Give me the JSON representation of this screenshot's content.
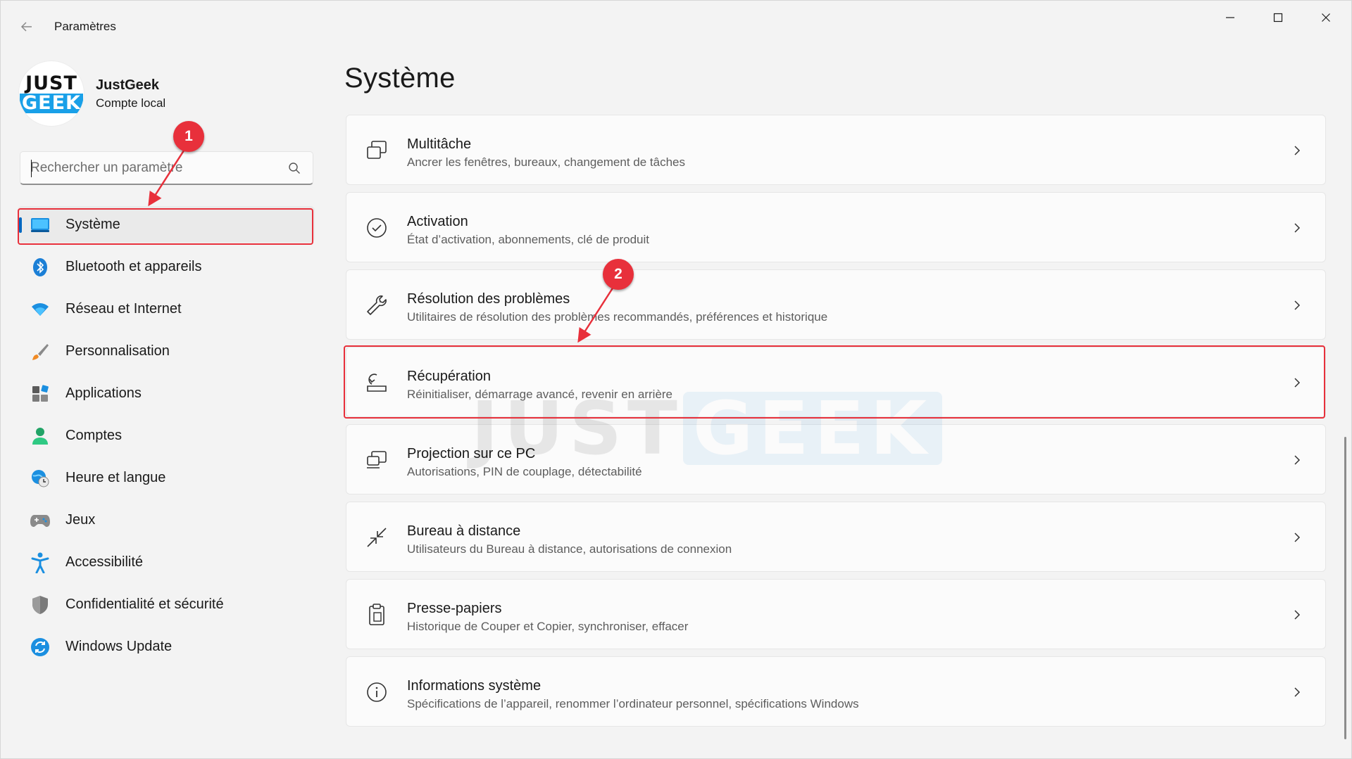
{
  "window": {
    "title": "Paramètres",
    "back_icon": "arrow-left-icon",
    "controls": [
      "minimize-icon",
      "maximize-icon",
      "close-icon"
    ]
  },
  "profile": {
    "avatar_line1": "JUST",
    "avatar_line2": "GEEK",
    "name": "JustGeek",
    "account_type": "Compte local"
  },
  "search": {
    "placeholder": "Rechercher un paramètre",
    "icon": "search-icon"
  },
  "sidebar": {
    "items": [
      {
        "label": "Système",
        "icon": "system-icon",
        "active": true
      },
      {
        "label": "Bluetooth et appareils",
        "icon": "bluetooth-icon"
      },
      {
        "label": "Réseau et Internet",
        "icon": "wifi-icon"
      },
      {
        "label": "Personnalisation",
        "icon": "brush-icon"
      },
      {
        "label": "Applications",
        "icon": "apps-icon"
      },
      {
        "label": "Comptes",
        "icon": "person-icon"
      },
      {
        "label": "Heure et langue",
        "icon": "globe-clock-icon"
      },
      {
        "label": "Jeux",
        "icon": "gamepad-icon"
      },
      {
        "label": "Accessibilité",
        "icon": "accessibility-icon"
      },
      {
        "label": "Confidentialité et sécurité",
        "icon": "shield-icon"
      },
      {
        "label": "Windows Update",
        "icon": "update-icon"
      }
    ]
  },
  "main": {
    "title": "Système",
    "cards": [
      {
        "title": "Multitâche",
        "subtitle": "Ancrer les fenêtres, bureaux, changement de tâches",
        "icon": "multitask-icon"
      },
      {
        "title": "Activation",
        "subtitle": "État d’activation, abonnements, clé de produit",
        "icon": "check-circle-icon"
      },
      {
        "title": "Résolution des problèmes",
        "subtitle": "Utilitaires de résolution des problèmes recommandés, préférences et historique",
        "icon": "wrench-icon"
      },
      {
        "title": "Récupération",
        "subtitle": "Réinitialiser, démarrage avancé, revenir en arrière",
        "icon": "recovery-icon"
      },
      {
        "title": "Projection sur ce PC",
        "subtitle": "Autorisations, PIN de couplage, détectabilité",
        "icon": "projection-icon"
      },
      {
        "title": "Bureau à distance",
        "subtitle": "Utilisateurs du Bureau à distance, autorisations de connexion",
        "icon": "remote-desktop-icon"
      },
      {
        "title": "Presse-papiers",
        "subtitle": "Historique de Couper et Copier, synchroniser, effacer",
        "icon": "clipboard-icon"
      },
      {
        "title": "Informations système",
        "subtitle": "Spécifications de l’appareil, renommer l’ordinateur personnel, spécifications Windows",
        "icon": "info-icon"
      }
    ]
  },
  "annotations": {
    "badge1": "1",
    "badge2": "2",
    "color": "#e8303b"
  },
  "watermark": {
    "part1": "JUST",
    "part2": "GEEK"
  },
  "colors": {
    "accent": "#0067c0",
    "background": "#f3f3f3",
    "card": "#fbfbfb"
  }
}
